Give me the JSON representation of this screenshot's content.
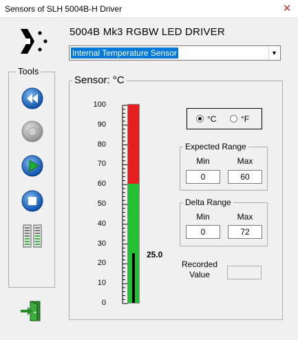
{
  "window": {
    "title": "Sensors of SLH 5004B-H  Driver",
    "close_glyph": "✕"
  },
  "app": {
    "heading": "5004B Mk3 RGBW LED DRIVER",
    "logo_icon": "logo-arrow-dots-icon"
  },
  "sensor_select": {
    "selected": "Internal Temperature Sensor",
    "arrow_glyph": "▼"
  },
  "tools": {
    "label": "Tools",
    "buttons": [
      {
        "name": "rewind-button",
        "icon": "rewind-icon"
      },
      {
        "name": "record-button",
        "icon": "record-icon",
        "enabled": false
      },
      {
        "name": "play-button",
        "icon": "play-icon"
      },
      {
        "name": "stop-button",
        "icon": "stop-icon"
      },
      {
        "name": "meters-button",
        "icon": "level-meters-icon"
      }
    ]
  },
  "sensor": {
    "label": "Sensor: °C",
    "scale_ticks": [
      "100",
      "90",
      "80",
      "70",
      "60",
      "50",
      "40",
      "30",
      "20",
      "10",
      "0"
    ],
    "scale_min": 0,
    "scale_max": 100,
    "warning_threshold": 60,
    "reading_value": 25,
    "reading_text": "25.0",
    "colors": {
      "normal": "#22c032",
      "warning": "#e3201d",
      "level": "#000000"
    }
  },
  "units": {
    "celsius_label": "°C",
    "fahrenheit_label": "°F",
    "selected": "celsius"
  },
  "expected_range": {
    "label": "Expected Range",
    "min_label": "Min",
    "max_label": "Max",
    "min": "0",
    "max": "60"
  },
  "delta_range": {
    "label": "Delta Range",
    "min_label": "Min",
    "max_label": "Max",
    "min": "0",
    "max": "72"
  },
  "recorded": {
    "label_line1": "Recorded",
    "label_line2": "Value",
    "value": ""
  },
  "exit": {
    "icon": "exit-door-icon"
  }
}
